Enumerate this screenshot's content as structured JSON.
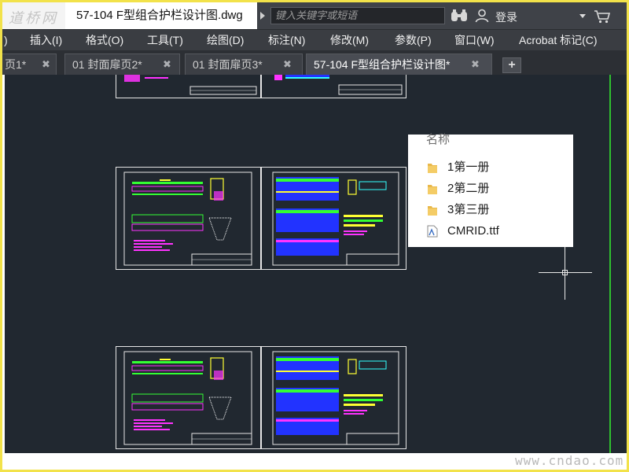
{
  "titlebar": {
    "logo_text": "道桥网",
    "doc_title": "57-104 F型组合护栏设计图.dwg",
    "search_placeholder": "键入关键字或短语",
    "login_label": "登录"
  },
  "menu": {
    "items": [
      {
        "label": ")"
      },
      {
        "label": "插入(I)"
      },
      {
        "label": "格式(O)"
      },
      {
        "label": "工具(T)"
      },
      {
        "label": "绘图(D)"
      },
      {
        "label": "标注(N)"
      },
      {
        "label": "修改(M)"
      },
      {
        "label": "参数(P)"
      },
      {
        "label": "窗口(W)"
      },
      {
        "label": "Acrobat 标记(C)"
      }
    ]
  },
  "tabs": {
    "items": [
      {
        "label": "页1*",
        "active": false
      },
      {
        "label": "01 封面扉页2*",
        "active": false
      },
      {
        "label": "01 封面扉页3*",
        "active": false
      },
      {
        "label": "57-104 F型组合护栏设计图*",
        "active": true
      }
    ],
    "close_glyph": "✖",
    "add_glyph": "+"
  },
  "file_panel": {
    "header": "名称",
    "entries": [
      {
        "label": "1第一册",
        "icon": "folder-icon"
      },
      {
        "label": "2第二册",
        "icon": "folder-icon"
      },
      {
        "label": "3第三册",
        "icon": "folder-icon"
      },
      {
        "label": "CMRID.ttf",
        "icon": "font-file-icon"
      }
    ]
  },
  "watermark": "www.cndao.com",
  "colors": {
    "canvas_bg": "#212830",
    "accent_green": "#2fbf2f",
    "drawing_magenta": "#ff33ff",
    "drawing_blue": "#2233ff",
    "drawing_yellow": "#ffff33",
    "drawing_cyan": "#33ffff"
  }
}
